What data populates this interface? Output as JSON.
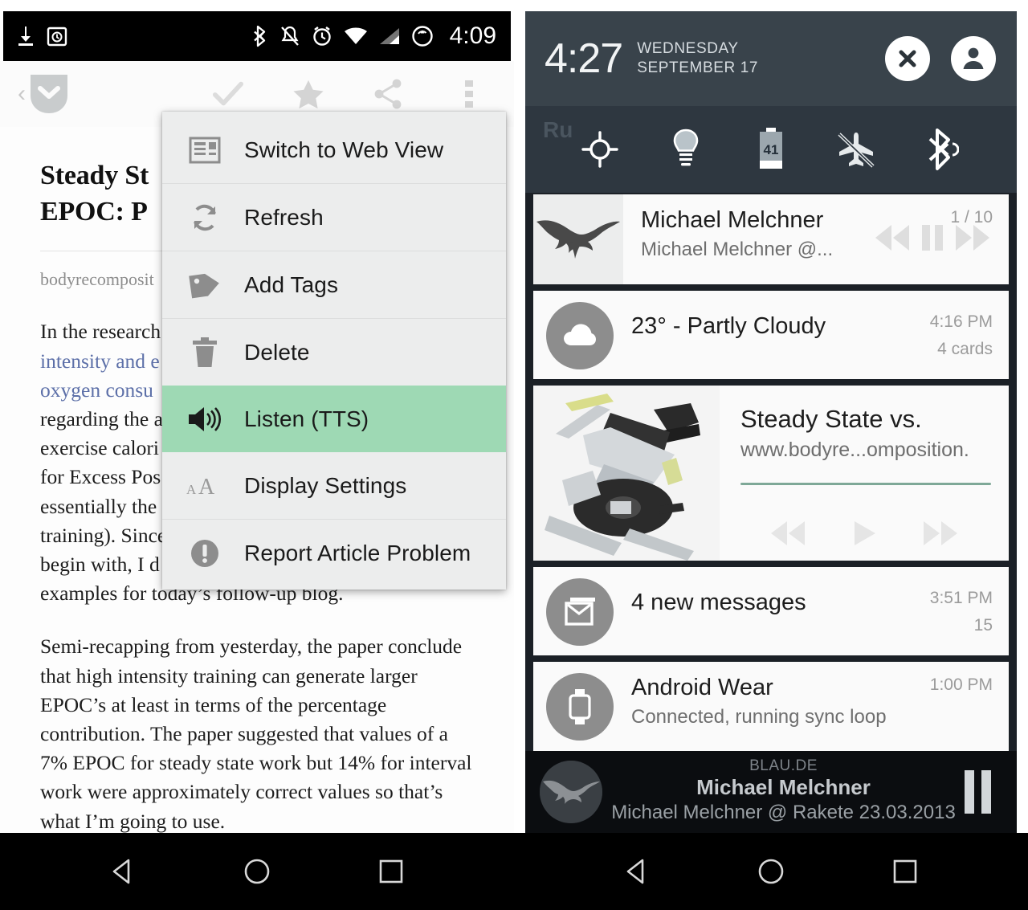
{
  "left_screen": {
    "status_bar": {
      "icons": [
        "download-icon",
        "calendar-icon",
        "bluetooth-icon",
        "silent-bell-icon",
        "alarm-icon",
        "wifi-icon",
        "signal-icon",
        "sync-icon"
      ],
      "time": "4:09"
    },
    "app_toolbar": {
      "back_label": "‹",
      "logo_name": "pocket-logo",
      "actions": [
        "archive-check-icon",
        "favorite-star-icon",
        "share-icon",
        "overflow-menu-icon"
      ]
    },
    "article": {
      "title_line1": "Steady St",
      "title_line2": "EPOC: P",
      "title_full": "Steady State vs. Intervals and EPOC: Practical Examples",
      "source": "bodyrecomposit",
      "source_full": "bodyrecomposition.com",
      "paragraph1_visible_lines": [
        "In the research",
        "intensity and e",
        "oxygen consu",
        "regarding the a",
        "exercise calori",
        "for Excess Pos",
        "essentially the",
        "training). Since",
        "begin with, I d",
        "examples for today’s follow-up blog."
      ],
      "paragraph2": "Semi-recapping from yesterday, the paper conclude that high intensity training can generate larger EPOC’s at least in terms of the percentage contribution. The paper suggested that values of a 7% EPOC for steady state work but 14% for interval work were approximately correct values so that’s what I’m going to use."
    },
    "overflow_menu": {
      "highlight_color": "#9ed9b4",
      "background": "#eceded",
      "items": [
        {
          "label": "Switch to Web View",
          "icon": "web-view-icon",
          "selected": false
        },
        {
          "label": "Refresh",
          "icon": "refresh-icon",
          "selected": false
        },
        {
          "label": "Add Tags",
          "icon": "tag-icon",
          "selected": false
        },
        {
          "label": "Delete",
          "icon": "trash-icon",
          "selected": false
        },
        {
          "label": "Listen (TTS)",
          "icon": "speaker-icon",
          "selected": true
        },
        {
          "label": "Display Settings",
          "icon": "font-size-icon",
          "selected": false
        },
        {
          "label": "Report Article Problem",
          "icon": "exclamation-icon",
          "selected": false
        }
      ]
    },
    "nav_bar": {
      "buttons": [
        "back-nav-icon",
        "home-nav-icon",
        "recents-nav-icon"
      ]
    }
  },
  "right_screen": {
    "quick_settings": {
      "clock": "4:27",
      "day": "WEDNESDAY",
      "date": "SEPTEMBER 17",
      "close_label": "×",
      "buttons": [
        "close-button",
        "user-profile-button"
      ],
      "ghost_text": "Ru",
      "ghost_text_2": "",
      "tiles": [
        {
          "name": "location-tile",
          "battery_level": ""
        },
        {
          "name": "brightness-tile",
          "battery_level": ""
        },
        {
          "name": "battery-tile",
          "battery_level": "41"
        },
        {
          "name": "airplane-mode-tile",
          "battery_level": ""
        },
        {
          "name": "bluetooth-tile",
          "battery_level": ""
        }
      ]
    },
    "notifications": [
      {
        "type": "media",
        "name": "notification-music-player",
        "title": "Michael Melchner",
        "subtitle": "Michael Melchner @...",
        "meta_top": "1 / 10",
        "meta_bottom": "",
        "icon": "album-art-eagle",
        "controls": [
          "previous-icon",
          "pause-icon",
          "next-icon"
        ]
      },
      {
        "type": "simple",
        "name": "notification-weather",
        "title": "23° - Partly Cloudy",
        "subtitle": "",
        "meta_top": "4:16 PM",
        "meta_bottom": "4 cards",
        "icon": "cloud-icon",
        "controls": []
      },
      {
        "type": "media-big",
        "name": "notification-pocket-article",
        "title": "Steady State vs.",
        "subtitle": "www.bodyre...omposition.",
        "meta_top": "",
        "meta_bottom": "",
        "icon": "exercise-bike-thumbnail",
        "controls": [
          "rewind-icon",
          "play-icon",
          "forward-icon"
        ]
      },
      {
        "type": "simple",
        "name": "notification-messages",
        "title": "4 new messages",
        "subtitle": "",
        "meta_top": "3:51 PM",
        "meta_bottom": "15",
        "icon": "gmail-icon",
        "controls": []
      },
      {
        "type": "simple",
        "name": "notification-android-wear",
        "title": "Android Wear",
        "subtitle": "Connected, running sync loop",
        "meta_top": "1:00 PM",
        "meta_bottom": "",
        "icon": "watch-icon",
        "controls": []
      }
    ],
    "media_footer": {
      "album": "BLAU.DE",
      "title": "Michael Melchner",
      "subtitle": "Michael Melchner @ Rakete 23.03.2013",
      "control": "pause-icon",
      "thumb": "album-art-eagle"
    },
    "nav_bar": {
      "buttons": [
        "back-nav-icon",
        "home-nav-icon",
        "recents-nav-icon"
      ]
    }
  }
}
